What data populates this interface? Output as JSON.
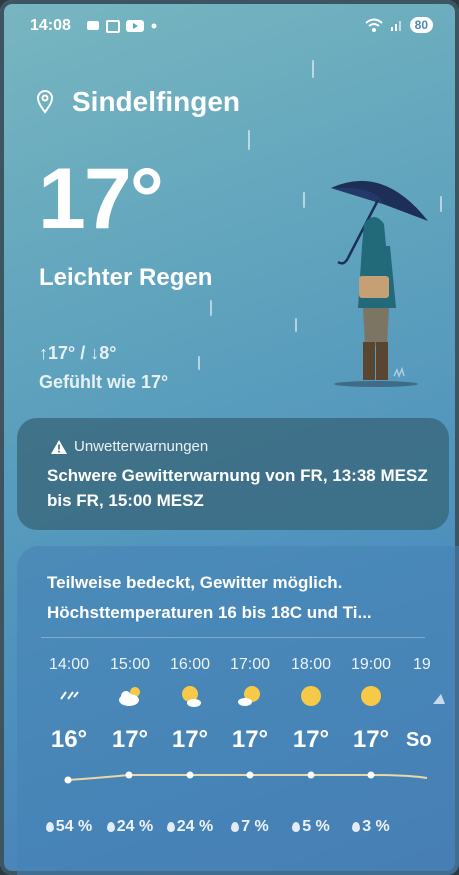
{
  "status_bar": {
    "time": "14:08",
    "battery": "80"
  },
  "location": {
    "city": "Sindelfingen",
    "icon": "location-pin-icon"
  },
  "current": {
    "temperature": "17°",
    "condition": "Leichter Regen",
    "high_low": "↑17° / ↓8°",
    "feels_like": "Gefühlt wie 17°"
  },
  "alert": {
    "title": "Unwetterwarnungen",
    "message": "Schwere Gewitterwarnung von FR, 13:38 MESZ bis FR, 15:00 MESZ"
  },
  "forecast": {
    "summary_line1": "Teilweise bedeckt, Gewitter möglich.",
    "summary_line2": "Höchsttemperaturen 16 bis 18C und Ti...",
    "hours": [
      {
        "time": "14:00",
        "icon": "rain-icon",
        "temp": "16°",
        "precip": "54 %"
      },
      {
        "time": "15:00",
        "icon": "cloud-sun-icon",
        "temp": "17°",
        "precip": "24 %"
      },
      {
        "time": "16:00",
        "icon": "sun-cloud-icon",
        "temp": "17°",
        "precip": "24 %"
      },
      {
        "time": "17:00",
        "icon": "sun-cloud-icon",
        "temp": "17°",
        "precip": "7 %"
      },
      {
        "time": "18:00",
        "icon": "sun-icon",
        "temp": "17°",
        "precip": "5 %"
      },
      {
        "time": "19:00",
        "icon": "sun-icon",
        "temp": "17°",
        "precip": "3 %"
      },
      {
        "time": "19",
        "icon": "sunset-icon",
        "temp": "So",
        "precip": ""
      }
    ]
  },
  "colors": {
    "accent": "#f7c948",
    "background": "#5fa3bd",
    "card": "#37647a"
  }
}
